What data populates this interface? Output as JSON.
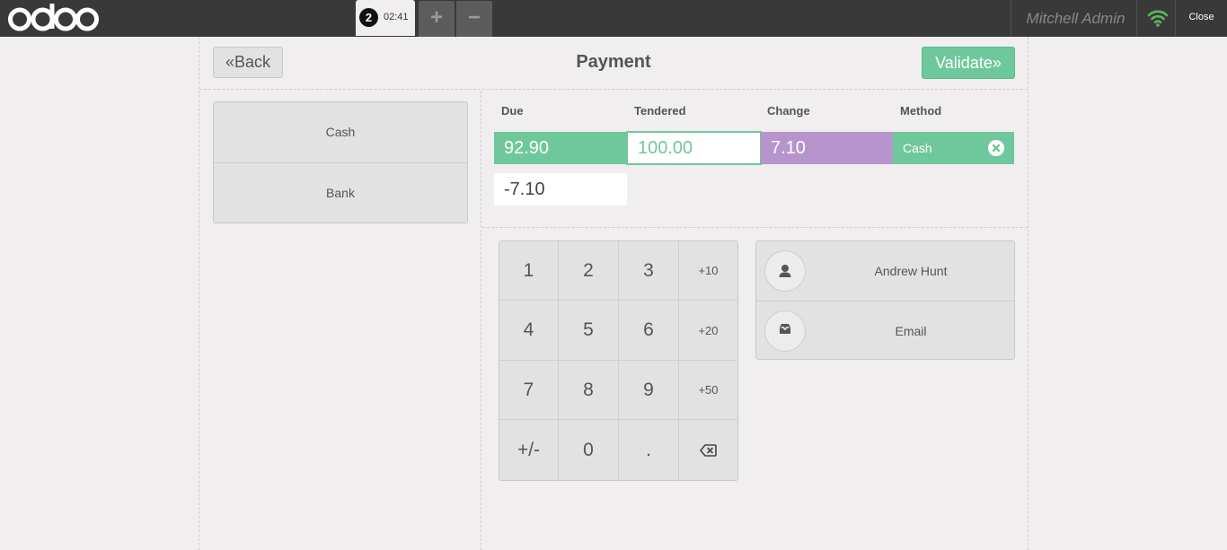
{
  "topbar": {
    "logo_text": "odoo",
    "order_number": "2",
    "order_time": "02:41",
    "add_order_label": "+",
    "remove_order_label": "−",
    "user_name": "Mitchell Admin",
    "close_label": "Close"
  },
  "header": {
    "back_label": "Back",
    "title": "Payment",
    "validate_label": "Validate"
  },
  "payment_methods": [
    "Cash",
    "Bank"
  ],
  "lines": {
    "headers": {
      "due": "Due",
      "tendered": "Tendered",
      "change": "Change",
      "method": "Method"
    },
    "due": "92.90",
    "tendered": "100.00",
    "change": "7.10",
    "method": "Cash",
    "remaining": "-7.10"
  },
  "numpad": {
    "keys": [
      "1",
      "2",
      "3",
      "+10",
      "4",
      "5",
      "6",
      "+20",
      "7",
      "8",
      "9",
      "+50",
      "+/-",
      "0",
      ".",
      "backspace"
    ]
  },
  "extras": {
    "customer": "Andrew Hunt",
    "email": "Email"
  },
  "colors": {
    "accent_green": "#6ec89b",
    "change_purple": "#b795cc",
    "topbar": "#393939",
    "background": "#f0eeee"
  },
  "icons": {
    "back": "double-chevron-left-icon",
    "validate": "double-chevron-right-icon",
    "remove": "close-circle-icon",
    "customer": "user-icon",
    "email": "inbox-icon",
    "backspace": "backspace-icon",
    "connection": "wifi-icon"
  }
}
